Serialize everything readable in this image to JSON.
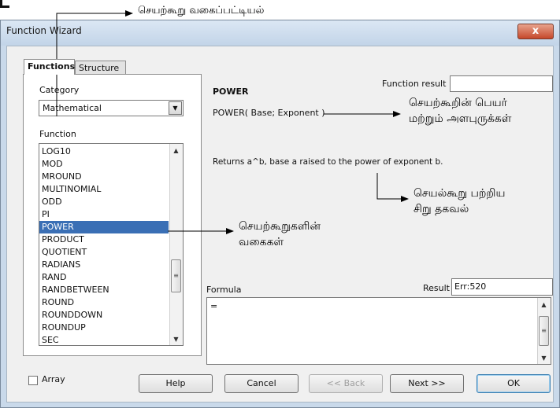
{
  "window": {
    "title": "Function Wizard",
    "close_glyph": "x"
  },
  "tabs": [
    {
      "label": "Functions",
      "active": true
    },
    {
      "label": "Structure",
      "active": false
    }
  ],
  "category": {
    "label": "Category",
    "value": "Mathematical"
  },
  "function_list": {
    "label": "Function",
    "items": [
      "LOG10",
      "MOD",
      "MROUND",
      "MULTINOMIAL",
      "ODD",
      "PI",
      "POWER",
      "PRODUCT",
      "QUOTIENT",
      "RADIANS",
      "RAND",
      "RANDBETWEEN",
      "ROUND",
      "ROUNDDOWN",
      "ROUNDUP",
      "SEC"
    ],
    "selected": "POWER"
  },
  "function_result": {
    "label": "Function result",
    "value": ""
  },
  "details": {
    "name": "POWER",
    "syntax": "POWER( Base; Exponent )",
    "description": "Returns a^b, base a raised to the power of exponent b."
  },
  "formula": {
    "label": "Formula",
    "value": "="
  },
  "result": {
    "label": "Result",
    "value": "Err:520"
  },
  "array": {
    "label": "Array",
    "checked": false
  },
  "buttons": {
    "help": "Help",
    "cancel": "Cancel",
    "back": "<< Back",
    "next": "Next >>",
    "ok": "OK"
  },
  "annotations": {
    "function_list": "செயற்கூறு வகைப்பட்டியல்",
    "name_params_1": "செயற்கூறின் பெயர்",
    "name_params_2": "மற்றும் அளபுருக்கள்",
    "info_1": "செயல்கூறு பற்றிய",
    "info_2": "சிறு தகவல்",
    "types_1": "செயற்கூறுகளின்",
    "types_2": "வகைகள்"
  },
  "colors": {
    "selection": "#3a6fb5",
    "title_bar": "#c9d9ea",
    "close_button": "#c5482b"
  }
}
